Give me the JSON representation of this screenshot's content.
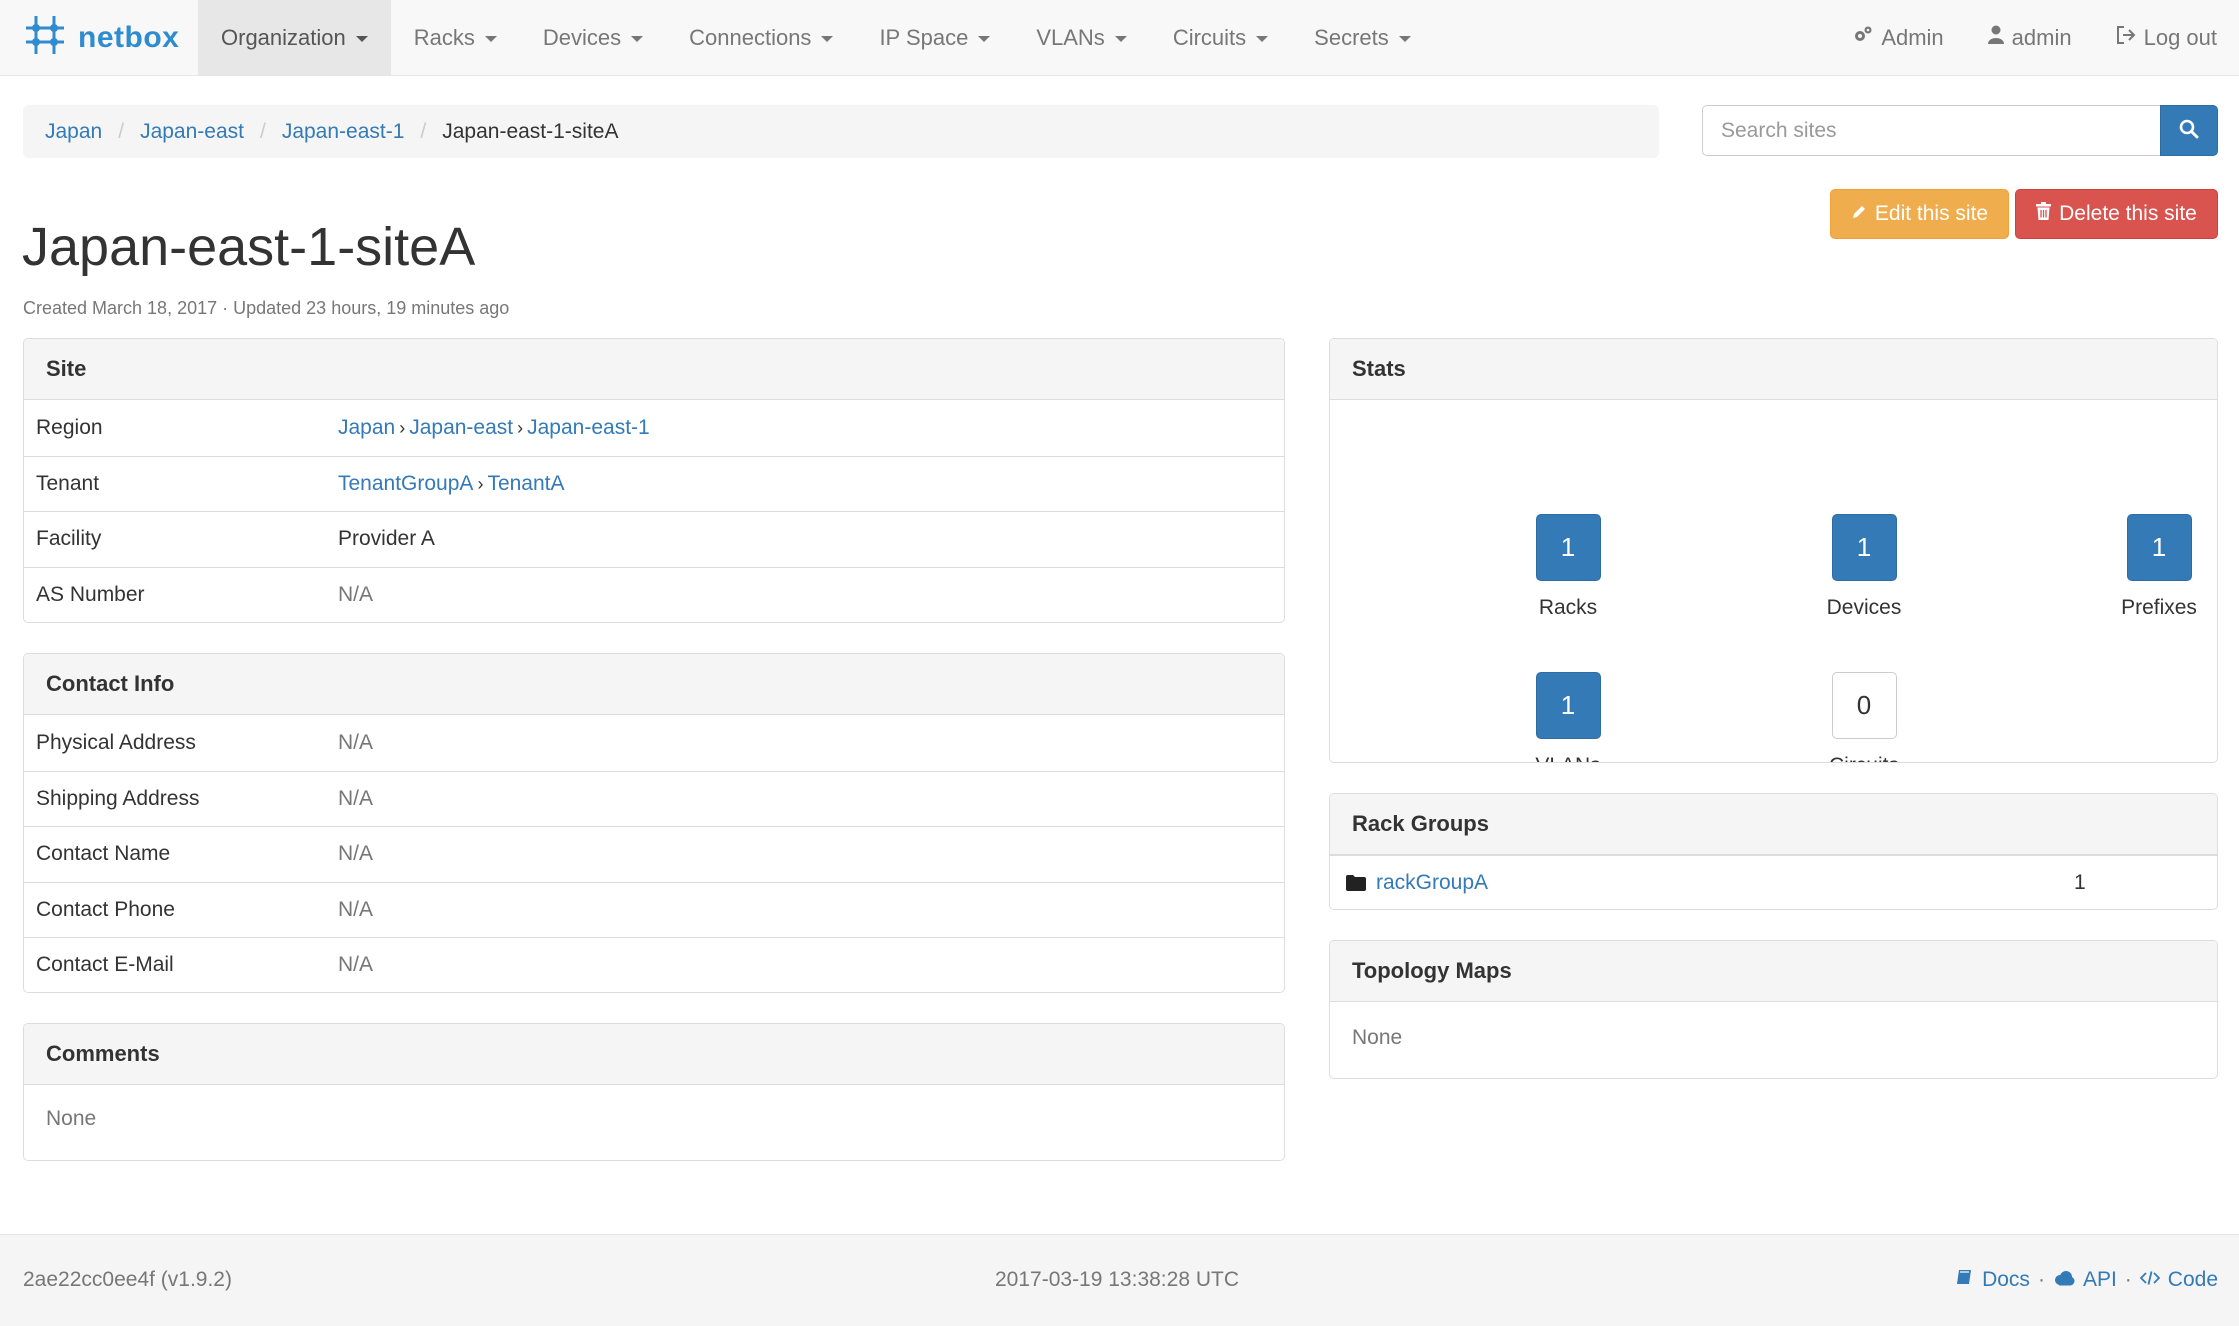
{
  "brand": {
    "name": "netbox"
  },
  "nav": {
    "items": [
      {
        "label": "Organization",
        "active": true
      },
      {
        "label": "Racks"
      },
      {
        "label": "Devices"
      },
      {
        "label": "Connections"
      },
      {
        "label": "IP Space"
      },
      {
        "label": "VLANs"
      },
      {
        "label": "Circuits"
      },
      {
        "label": "Secrets"
      }
    ],
    "right": {
      "admin_panel": "Admin",
      "user": "admin",
      "logout": "Log out"
    }
  },
  "breadcrumb": [
    "Japan",
    "Japan-east",
    "Japan-east-1",
    "Japan-east-1-siteA"
  ],
  "search": {
    "placeholder": "Search sites"
  },
  "actions": {
    "edit": "Edit this site",
    "delete": "Delete this site"
  },
  "page": {
    "title": "Japan-east-1-siteA",
    "meta": "Created March 18, 2017 · Updated 23 hours, 19 minutes ago"
  },
  "site_panel": {
    "heading": "Site",
    "region_label": "Region",
    "region": [
      "Japan",
      "Japan-east",
      "Japan-east-1"
    ],
    "tenant_label": "Tenant",
    "tenant_group": "TenantGroupA",
    "tenant": "TenantA",
    "facility_label": "Facility",
    "facility": "Provider A",
    "asn_label": "AS Number",
    "asn": "N/A"
  },
  "contact_panel": {
    "heading": "Contact Info",
    "rows": [
      {
        "label": "Physical Address",
        "value": "N/A"
      },
      {
        "label": "Shipping Address",
        "value": "N/A"
      },
      {
        "label": "Contact Name",
        "value": "N/A"
      },
      {
        "label": "Contact Phone",
        "value": "N/A"
      },
      {
        "label": "Contact E-Mail",
        "value": "N/A"
      }
    ]
  },
  "comments_panel": {
    "heading": "Comments",
    "body": "None"
  },
  "stats_panel": {
    "heading": "Stats",
    "items": [
      {
        "count": "1",
        "label": "Racks"
      },
      {
        "count": "1",
        "label": "Devices"
      },
      {
        "count": "1",
        "label": "Prefixes"
      },
      {
        "count": "1",
        "label": "VLANs"
      },
      {
        "count": "0",
        "label": "Circuits"
      }
    ]
  },
  "rack_groups_panel": {
    "heading": "Rack Groups",
    "rows": [
      {
        "name": "rackGroupA",
        "count": "1"
      }
    ]
  },
  "topology_panel": {
    "heading": "Topology Maps",
    "body": "None"
  },
  "footer": {
    "version": "2ae22cc0ee4f (v1.9.2)",
    "timestamp": "2017-03-19 13:38:28 UTC",
    "links": {
      "docs": "Docs",
      "api": "API",
      "code": "Code"
    }
  },
  "colors": {
    "primary": "#337ab7",
    "warning": "#f0ad4e",
    "danger": "#d9534f",
    "brand": "#2f8ccf"
  }
}
